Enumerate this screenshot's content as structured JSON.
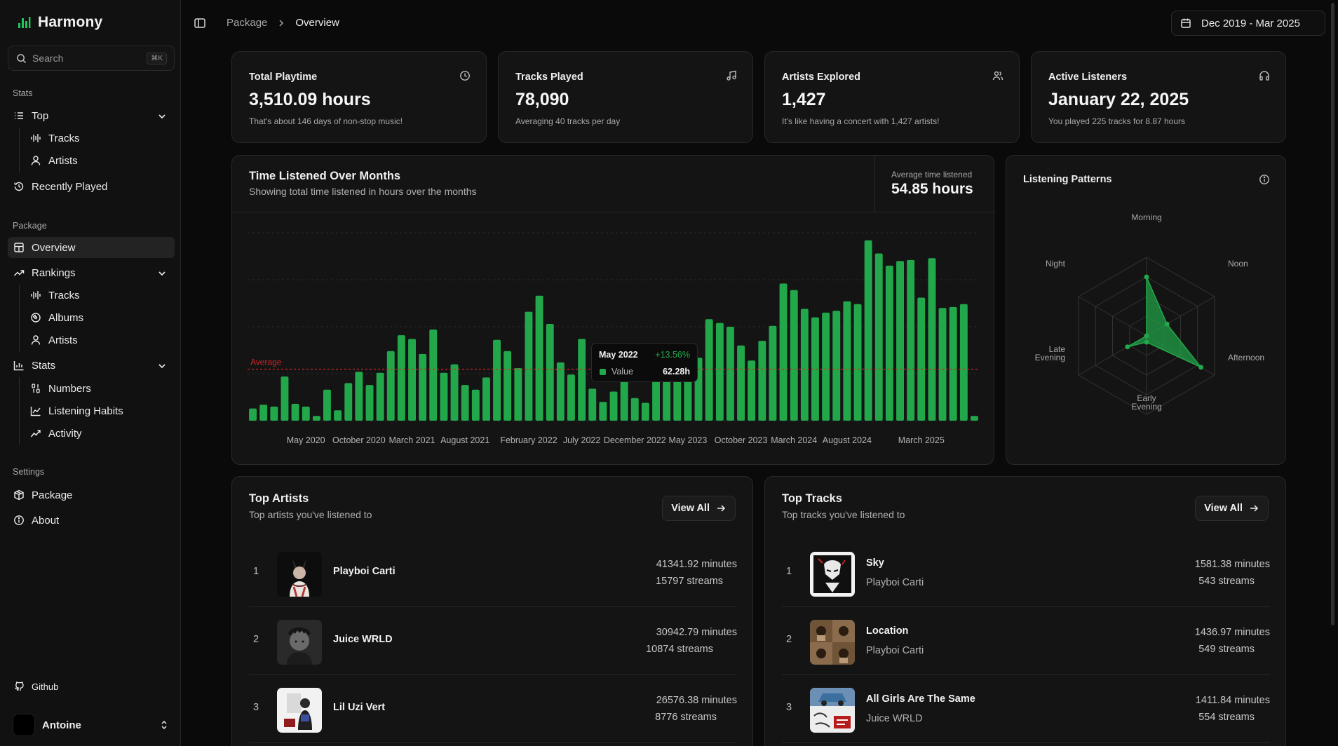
{
  "app": {
    "name": "Harmony"
  },
  "search": {
    "placeholder": "Search",
    "shortcut": "⌘K"
  },
  "sidebar": {
    "stats_label": "Stats",
    "top": {
      "label": "Top",
      "items": [
        "Tracks",
        "Artists"
      ]
    },
    "recently_played": "Recently Played",
    "package_label": "Package",
    "overview": "Overview",
    "rankings": {
      "label": "Rankings",
      "items": [
        "Tracks",
        "Albums",
        "Artists"
      ]
    },
    "stats": {
      "label": "Stats",
      "items": [
        "Numbers",
        "Listening Habits",
        "Activity"
      ]
    },
    "settings_label": "Settings",
    "package": "Package",
    "about": "About",
    "github": "Github",
    "user": "Antoine"
  },
  "breadcrumb": {
    "parent": "Package",
    "current": "Overview"
  },
  "date_range": "Dec 2019 - Mar 2025",
  "stats": [
    {
      "title": "Total Playtime",
      "value": "3,510.09 hours",
      "sub": "That's about 146 days of non-stop music!",
      "icon": "clock-icon"
    },
    {
      "title": "Tracks Played",
      "value": "78,090",
      "sub": "Averaging 40 tracks per day",
      "icon": "music-note-icon"
    },
    {
      "title": "Artists Explored",
      "value": "1,427",
      "sub": "It's like having a concert with 1,427 artists!",
      "icon": "users-icon"
    },
    {
      "title": "Active Listeners",
      "value": "January 22, 2025",
      "sub": "You played 225 tracks for 8.87 hours",
      "icon": "headphones-icon"
    }
  ],
  "time_chart": {
    "title": "Time Listened Over Months",
    "description": "Showing total time listened in hours over the months",
    "avg_label": "Average time listened",
    "avg_value": "54.85 hours",
    "average_line_label": "Average",
    "tooltip": {
      "title": "May 2022",
      "change": "+13.56%",
      "key": "Value",
      "value": "62.28h"
    }
  },
  "chart_data": {
    "type": "bar",
    "xlabel": "",
    "ylabel": "",
    "tick_labels": [
      "May 2020",
      "October 2020",
      "March 2021",
      "August 2021",
      "February 2022",
      "July 2022",
      "December 2022",
      "May 2023",
      "October 2023",
      "March 2024",
      "August 2024",
      "March 2025"
    ],
    "values": [
      13,
      17,
      15,
      47,
      18,
      15,
      5,
      33,
      11,
      40,
      52,
      38,
      51,
      74,
      91,
      87,
      71,
      97,
      51,
      60,
      38,
      33,
      46,
      86,
      74,
      56,
      116,
      133,
      103,
      62,
      49,
      87,
      34,
      20,
      31,
      43,
      24,
      19,
      62,
      64,
      46,
      49,
      67,
      108,
      104,
      100,
      80,
      64,
      85,
      101,
      146,
      139,
      119,
      110,
      115,
      117,
      127,
      124,
      192,
      178,
      165,
      170,
      171,
      131,
      173,
      120,
      121,
      124,
      5
    ],
    "average": 54.85,
    "ylim": [
      0,
      200
    ],
    "grid": true,
    "color": "#22a84a",
    "average_color": "#d02626"
  },
  "radar": {
    "title": "Listening Patterns",
    "labels": [
      "Morning",
      "Noon",
      "Afternoon",
      "Early Evening",
      "Late Evening",
      "Night"
    ],
    "values": [
      0.75,
      0.3,
      0.8,
      0.08,
      0.28,
      0.0
    ],
    "fill": "#22a84a"
  },
  "top_artists": {
    "title": "Top Artists",
    "description": "Top artists you've listened to",
    "view_all": "View All",
    "items": [
      {
        "rank": "1",
        "name": "Playboi Carti",
        "minutes": "41341.92 minutes",
        "streams": "15797 streams"
      },
      {
        "rank": "2",
        "name": "Juice WRLD",
        "minutes": "30942.79 minutes",
        "streams": "10874 streams"
      },
      {
        "rank": "3",
        "name": "Lil Uzi Vert",
        "minutes": "26576.38 minutes",
        "streams": "8776 streams"
      }
    ]
  },
  "top_tracks": {
    "title": "Top Tracks",
    "description": "Top tracks you've listened to",
    "view_all": "View All",
    "items": [
      {
        "rank": "1",
        "name": "Sky",
        "artist": "Playboi Carti",
        "minutes": "1581.38 minutes",
        "streams": "543 streams"
      },
      {
        "rank": "2",
        "name": "Location",
        "artist": "Playboi Carti",
        "minutes": "1436.97 minutes",
        "streams": "549 streams"
      },
      {
        "rank": "3",
        "name": "All Girls Are The Same",
        "artist": "Juice WRLD",
        "minutes": "1411.84 minutes",
        "streams": "554 streams"
      }
    ]
  }
}
